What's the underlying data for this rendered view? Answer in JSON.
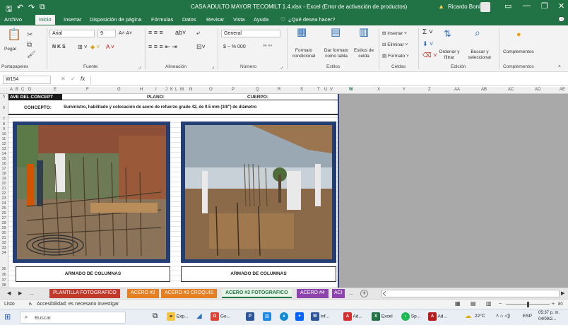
{
  "window": {
    "title": "CASA ADULTO MAYOR TECOMILT 1.4.xlsx - Excel (Error de activación de productos)",
    "user": "Ricardo Bonilla",
    "accent": "#217346"
  },
  "ribbon_tabs": [
    "Archivo",
    "Inicio",
    "Insertar",
    "Disposición de página",
    "Fórmulas",
    "Datos",
    "Revisar",
    "Vista",
    "Ayuda",
    "¿Qué desea hacer?"
  ],
  "ribbon": {
    "clipboard": {
      "paste": "Pegar",
      "label": "Portapapeles"
    },
    "font": {
      "name": "Arial",
      "size": "9",
      "label": "Fuente",
      "buttons": "N  K  S"
    },
    "alignment": {
      "label": "Alineación"
    },
    "number": {
      "format": "General",
      "label": "Número",
      "currency": "$ ~ %  000"
    },
    "styles": {
      "conditional": "Formato condicional",
      "as_table": "Dar formato como tabla",
      "cell_styles": "Estilos de celda",
      "label": "Estilos"
    },
    "cells": {
      "insert": "Insertar",
      "delete": "Eliminar",
      "format": "Formato",
      "label": "Celdas"
    },
    "editing": {
      "sort": "Ordenar y filtrar",
      "find": "Buscar y seleccionar",
      "label": "Edición"
    },
    "addins": {
      "name": "Complementos",
      "label": "Complementos"
    }
  },
  "formula_bar": {
    "name_box": "W154",
    "fx": "fx",
    "value": ""
  },
  "columns_left": [
    "A",
    "B",
    "C",
    "D",
    "E",
    "F",
    "G",
    "H",
    "I",
    "J",
    "K",
    "L",
    "M",
    "N",
    "O",
    "P",
    "Q",
    "R",
    "S",
    "T",
    "U",
    "V"
  ],
  "columns_right": [
    "W",
    "X",
    "Y",
    "Z",
    "AA",
    "AB",
    "AC",
    "AD",
    "AE"
  ],
  "rows": [
    "5",
    "6",
    "7",
    "8",
    "9",
    "10",
    "11",
    "12",
    "13",
    "14",
    "15",
    "16",
    "17",
    "18",
    "19",
    "20",
    "21",
    "22",
    "23",
    "24",
    "25",
    "26",
    "27",
    "28",
    "29",
    "30",
    "31",
    "32",
    "33",
    "34",
    "35",
    "36",
    "37",
    "38"
  ],
  "sheet": {
    "clave_label": "AVE DEL CONCEPT",
    "plano_label": "PLANO:",
    "cuerpo_label": "CUERPO:",
    "concepto_label": "CONCEPTO:",
    "concepto_text": "Suministro, habilitado y colocación de acero de refuerzo grado 42, de 9.5 mm (3/8\") de diámetro",
    "caption_left": "ARMADO DE COLUMNAS",
    "caption_right": "ARMADO DE COLUMNAS"
  },
  "sheet_tabs": [
    {
      "label": "PLANTILLA FOTOGRAFICO",
      "color": "#c0392b"
    },
    {
      "label": "ACERO #2",
      "color": "#e67e22"
    },
    {
      "label": "ACERO #3 CROQUIS",
      "color": "#e67e22"
    },
    {
      "label": "ACERO #3 FOTOGRAFICO",
      "color": "#e8f5e9"
    },
    {
      "label": "ACERO #4",
      "color": "#8e44ad"
    },
    {
      "label": "ACI",
      "color": "#8e44ad"
    }
  ],
  "sheet_nav": {
    "ellipsis": "...",
    "more": "...",
    "add": "+"
  },
  "status": {
    "ready": "Listo",
    "accessibility": "Accesibilidad: es necesario investigar",
    "zoom": "80"
  },
  "taskbar": {
    "search": "Buscar",
    "apps": [
      "Exp...",
      "Go...",
      "inf...",
      "Ad...",
      "Excel",
      "Sp...",
      "Ad..."
    ],
    "weather": "22°C",
    "lang": "ESP",
    "time": "05:37 p. m.",
    "date": "04/09/2..."
  }
}
